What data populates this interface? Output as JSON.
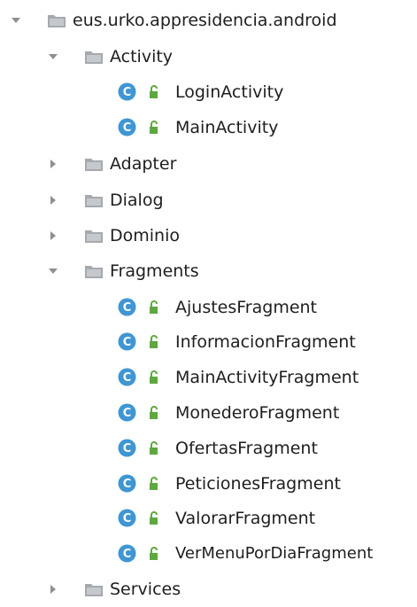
{
  "colors": {
    "arrow": "#8f8f8f",
    "folder": "#a6a9ae",
    "class_badge": "#3f96d3",
    "access_icon": "#5ea840",
    "text": "#1e1e1e"
  },
  "tree": {
    "package": {
      "label": "eus.urko.appresidencia.android",
      "icon": "package-folder-icon",
      "expanded": true
    },
    "folders": {
      "activity": {
        "label": "Activity",
        "expanded": true
      },
      "adapter": {
        "label": "Adapter",
        "expanded": false
      },
      "dialog": {
        "label": "Dialog",
        "expanded": false
      },
      "dominio": {
        "label": "Dominio",
        "expanded": false
      },
      "fragments": {
        "label": "Fragments",
        "expanded": true
      },
      "services": {
        "label": "Services",
        "expanded": false
      }
    },
    "activity_classes": [
      {
        "label": "LoginActivity",
        "icon": "class-icon"
      },
      {
        "label": "MainActivity",
        "icon": "class-icon"
      }
    ],
    "fragment_classes": [
      {
        "label": "AjustesFragment",
        "icon": "class-icon"
      },
      {
        "label": "InformacionFragment",
        "icon": "class-icon"
      },
      {
        "label": "MainActivityFragment",
        "icon": "class-icon"
      },
      {
        "label": "MonederoFragment",
        "icon": "class-icon"
      },
      {
        "label": "OfertasFragment",
        "icon": "class-icon"
      },
      {
        "label": "PeticionesFragment",
        "icon": "class-icon"
      },
      {
        "label": "ValorarFragment",
        "icon": "class-icon"
      },
      {
        "label": "VerMenuPorDiaFragment",
        "icon": "class-icon"
      }
    ],
    "class_badge_letter": "C"
  }
}
